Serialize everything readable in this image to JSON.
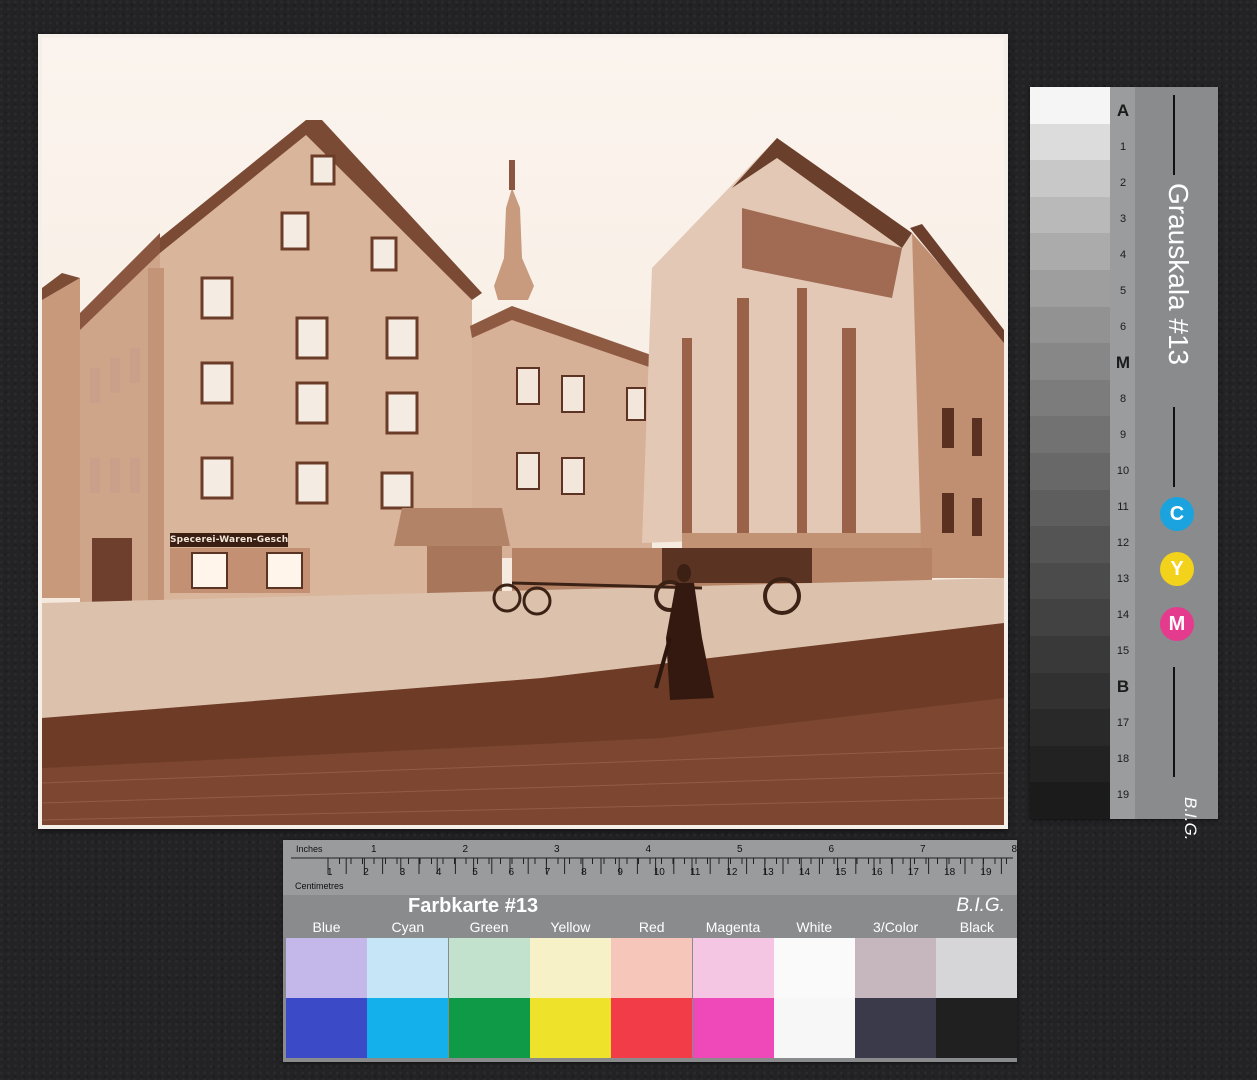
{
  "photo": {
    "shop_sign": "Specerei-Waren-Geschäft"
  },
  "grayscale_card": {
    "title": "Grauskala #13",
    "brand": "B.I.G.",
    "scale_labels": [
      "A",
      "1",
      "2",
      "3",
      "4",
      "5",
      "6",
      "M",
      "8",
      "9",
      "10",
      "11",
      "12",
      "13",
      "14",
      "15",
      "B",
      "17",
      "18",
      "19"
    ],
    "cym": [
      {
        "label": "C",
        "color": "#1aa3de"
      },
      {
        "label": "Y",
        "color": "#f2d21a"
      },
      {
        "label": "M",
        "color": "#e43b8e"
      }
    ],
    "steps": [
      "#f5f5f5",
      "#dcdcdc",
      "#c8c8c8",
      "#b9b9b9",
      "#ababab",
      "#9e9e9e",
      "#929292",
      "#878787",
      "#7c7c7c",
      "#727272",
      "#686868",
      "#5e5e5e",
      "#545454",
      "#4b4b4b",
      "#424242",
      "#393939",
      "#313131",
      "#292929",
      "#222222",
      "#1b1b1b"
    ]
  },
  "color_card": {
    "title": "Farbkarte #13",
    "brand": "B.I.G.",
    "ruler": {
      "inches_label": "Inches",
      "centimetres_label": "Centimetres",
      "inch_numbers": [
        "1",
        "2",
        "3",
        "4",
        "5",
        "6",
        "7",
        "8"
      ],
      "cm_numbers": [
        "1",
        "2",
        "3",
        "4",
        "5",
        "6",
        "7",
        "8",
        "9",
        "10",
        "11",
        "12",
        "13",
        "14",
        "15",
        "16",
        "17",
        "18",
        "19"
      ]
    },
    "swatches": [
      {
        "label": "Blue",
        "light": "#c4b7ea",
        "dark": "#3b4bc8"
      },
      {
        "label": "Cyan",
        "light": "#c6e6f7",
        "dark": "#14b0ec"
      },
      {
        "label": "Green",
        "light": "#c3e2cd",
        "dark": "#0e9a47"
      },
      {
        "label": "Yellow",
        "light": "#f6f1c6",
        "dark": "#efe22a"
      },
      {
        "label": "Red",
        "light": "#f6c6bb",
        "dark": "#f23d48"
      },
      {
        "label": "Magenta",
        "light": "#f4c6e4",
        "dark": "#ee48b9"
      },
      {
        "label": "White",
        "light": "#fafafa",
        "dark": "#f7f7f7"
      },
      {
        "label": "3/Color",
        "light": "#c6b6bd",
        "dark": "#3a3a4a"
      },
      {
        "label": "Black",
        "light": "#d6d6d8",
        "dark": "#202020"
      }
    ]
  }
}
